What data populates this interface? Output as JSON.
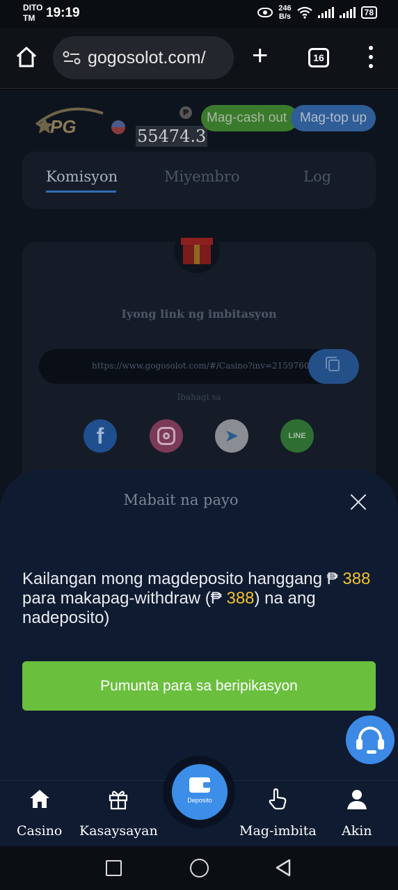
{
  "status_bar": {
    "carrier_line1": "DITO",
    "carrier_line2": "TM",
    "time": "19:19",
    "net_speed_value": "246",
    "net_speed_unit": "B/s",
    "battery": "78",
    "icons": [
      "eye-icon",
      "wifi-icon",
      "signal-icon",
      "signal-icon",
      "battery-icon"
    ]
  },
  "browser": {
    "url": "gogosolot.com/",
    "tab_count": "16",
    "icons": [
      "home-icon",
      "site-info-icon",
      "plus-icon",
      "tabs-icon",
      "more-vert-icon"
    ]
  },
  "header": {
    "logo_text": "PG",
    "currency_badge": "₱",
    "balance": "55474.3",
    "cashout_label": "Mag-cash out",
    "topup_label": "Mag-top up"
  },
  "tabs": {
    "items": [
      {
        "label": "Komisyon",
        "active": true
      },
      {
        "label": "Miyembro",
        "active": false
      },
      {
        "label": "Log",
        "active": false
      }
    ]
  },
  "invite": {
    "title": "Iyong link ng imbitasyon",
    "link": "https://www.gogosolot.com/#/Casino?inv=2159760",
    "share_label": "Ibahagi sa",
    "social": [
      {
        "name": "facebook",
        "glyph": "f"
      },
      {
        "name": "instagram",
        "glyph": ""
      },
      {
        "name": "telegram",
        "glyph": "➤"
      },
      {
        "name": "line",
        "glyph": "LINE"
      }
    ]
  },
  "modal": {
    "title": "Mabait na payo",
    "message_part1": "Kailangan mong magdeposito hanggang ₱ ",
    "amount1": "388",
    "message_part2": " para makapag-withdraw (₱ ",
    "amount2": "388",
    "message_part3": ") na ang nadeposito)",
    "button_label": "Pumunta para sa beripikasyon"
  },
  "bottom_nav": {
    "items": [
      {
        "label": "Casino",
        "icon": "home-icon"
      },
      {
        "label": "Kasaysayan",
        "icon": "gift-icon"
      },
      {
        "label": "Deposito",
        "icon": "wallet-icon"
      },
      {
        "label": "Mag-imbita",
        "icon": "hand-pointer-icon"
      },
      {
        "label": "Akin",
        "icon": "user-icon"
      }
    ]
  },
  "colors": {
    "modal_bg": "#0f1b30",
    "accent_green": "#6abf3c",
    "accent_blue": "#3c8ee9",
    "highlight_yellow": "#f2c230"
  }
}
